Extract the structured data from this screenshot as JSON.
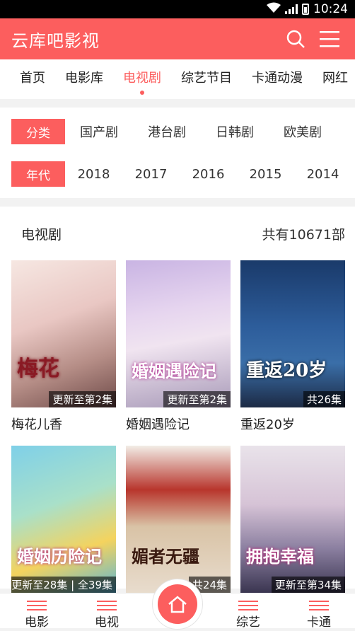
{
  "status": {
    "time": "10:24"
  },
  "app": {
    "title": "云库吧影视"
  },
  "tabs": [
    {
      "label": "首页"
    },
    {
      "label": "电影库"
    },
    {
      "label": "电视剧"
    },
    {
      "label": "综艺节目"
    },
    {
      "label": "卡通动漫"
    },
    {
      "label": "网红"
    }
  ],
  "filters": {
    "category_label": "分类",
    "categories": [
      "国产剧",
      "港台剧",
      "日韩剧",
      "欧美剧"
    ],
    "year_label": "年代",
    "years": [
      "2018",
      "2017",
      "2016",
      "2015",
      "2014"
    ]
  },
  "section": {
    "title": "电视剧",
    "count": "共有10671部"
  },
  "items": [
    {
      "name": "梅花儿香",
      "badge": "更新至第2集",
      "poster_text": "梅花"
    },
    {
      "name": "婚姻遇险记",
      "badge": "更新至第2集",
      "poster_text": "婚姻遇险记"
    },
    {
      "name": "重返20岁",
      "badge": "共26集",
      "poster_text": "重返20岁"
    },
    {
      "name": "",
      "badge": "更新至28集 | 全39集",
      "poster_text": "婚姻历险记"
    },
    {
      "name": "",
      "badge": "共24集",
      "poster_text": "媚者无疆"
    },
    {
      "name": "",
      "badge": "更新至第34集",
      "poster_text": "拥抱幸福"
    }
  ],
  "bottom_nav": {
    "movies": "电影",
    "tv": "电视",
    "variety": "综艺",
    "cartoon": "卡通"
  },
  "colors": {
    "accent": "#fc5e5e"
  }
}
